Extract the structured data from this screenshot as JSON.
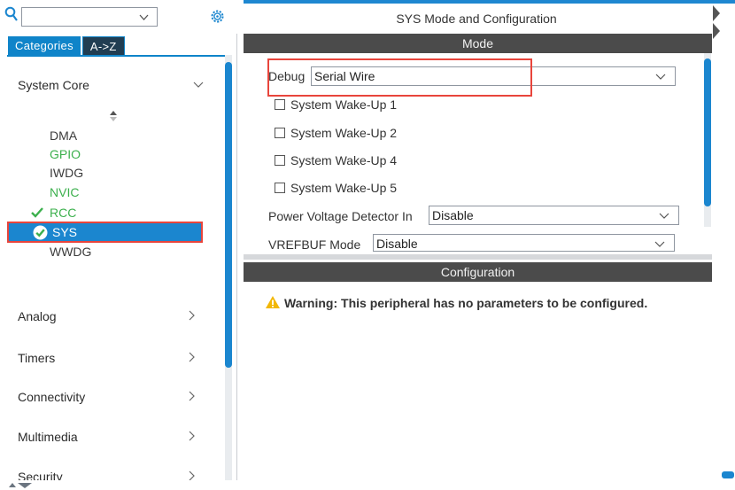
{
  "left_panel": {
    "search": {
      "value": "",
      "placeholder": ""
    },
    "tabs": {
      "categories": "Categories",
      "az": "A->Z"
    },
    "categories": [
      {
        "label": "System Core",
        "expanded": true
      },
      {
        "label": "Analog",
        "expanded": false
      },
      {
        "label": "Timers",
        "expanded": false
      },
      {
        "label": "Connectivity",
        "expanded": false
      },
      {
        "label": "Multimedia",
        "expanded": false
      },
      {
        "label": "Security",
        "expanded": false
      }
    ],
    "system_core_items": [
      {
        "label": "DMA",
        "state": "normal"
      },
      {
        "label": "GPIO",
        "state": "configured"
      },
      {
        "label": "IWDG",
        "state": "normal"
      },
      {
        "label": "NVIC",
        "state": "configured"
      },
      {
        "label": "RCC",
        "state": "checked"
      },
      {
        "label": "SYS",
        "state": "selected"
      },
      {
        "label": "WWDG",
        "state": "normal"
      }
    ]
  },
  "right_panel": {
    "title": "SYS Mode and Configuration",
    "mode_header": "Mode",
    "debug": {
      "label": "Debug",
      "value": "Serial Wire"
    },
    "checkboxes": [
      {
        "label": "System Wake-Up 1",
        "checked": false
      },
      {
        "label": "System Wake-Up 2",
        "checked": false
      },
      {
        "label": "System Wake-Up 4",
        "checked": false
      },
      {
        "label": "System Wake-Up 5",
        "checked": false
      }
    ],
    "pvd": {
      "label": "Power Voltage Detector In",
      "value": "Disable"
    },
    "vrefbuf": {
      "label": "VREFBUF Mode",
      "value": "Disable"
    },
    "config_header": "Configuration",
    "warning": "Warning: This peripheral has no parameters to be configured."
  },
  "colors": {
    "accent": "#1b86cf",
    "header": "#4b4b4b",
    "configured_green": "#3cb04d",
    "highlight_red": "#e8453c",
    "warning_yellow": "#f2b705"
  },
  "icons": [
    "search-icon",
    "gear-icon",
    "chevron-down-icon",
    "chevron-right-icon",
    "checkmark-icon",
    "check-circle-icon",
    "sort-icon",
    "warning-icon"
  ]
}
